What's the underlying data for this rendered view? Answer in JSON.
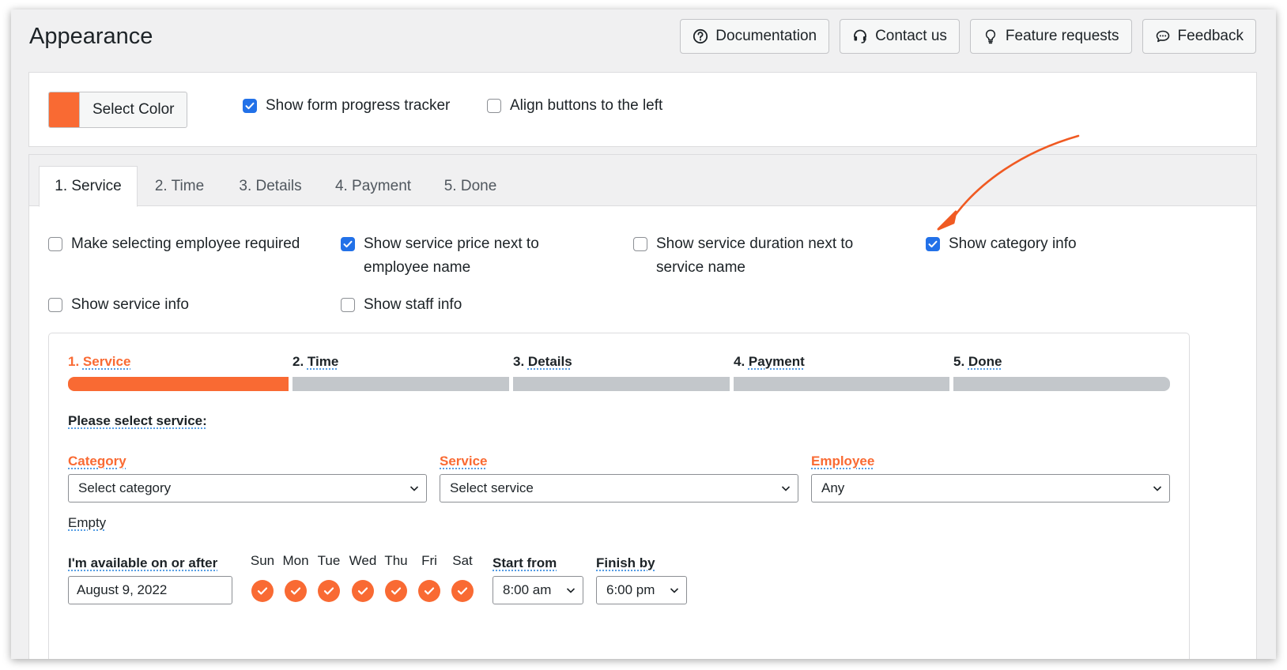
{
  "header": {
    "title": "Appearance",
    "buttons": [
      {
        "label": "Documentation",
        "icon": "question-circle-icon"
      },
      {
        "label": "Contact us",
        "icon": "headset-icon"
      },
      {
        "label": "Feature requests",
        "icon": "lightbulb-icon"
      },
      {
        "label": "Feedback",
        "icon": "chat-bubble-icon"
      }
    ]
  },
  "settings": {
    "select_color_label": "Select Color",
    "accent_color": "#f96a33",
    "show_progress_tracker": {
      "label": "Show form progress tracker",
      "checked": true
    },
    "align_left": {
      "label": "Align buttons to the left",
      "checked": false
    }
  },
  "tabs": [
    {
      "label": "1. Service",
      "active": true
    },
    {
      "label": "2. Time",
      "active": false
    },
    {
      "label": "3. Details",
      "active": false
    },
    {
      "label": "4. Payment",
      "active": false
    },
    {
      "label": "5. Done",
      "active": false
    }
  ],
  "options": {
    "employee_required": {
      "label": "Make selecting employee required",
      "checked": false
    },
    "service_price": {
      "label_line1": "Show service price next to",
      "label_line2": "employee name",
      "checked": true
    },
    "service_duration": {
      "label_line1": "Show service duration next to",
      "label_line2": "service name",
      "checked": false
    },
    "category_info": {
      "label": "Show category info",
      "checked": true
    },
    "service_info": {
      "label": "Show service info",
      "checked": false
    },
    "staff_info": {
      "label": "Show staff info",
      "checked": false
    }
  },
  "preview": {
    "steps": [
      {
        "num": "1.",
        "label": "Service",
        "active": true
      },
      {
        "num": "2.",
        "label": "Time",
        "active": false
      },
      {
        "num": "3.",
        "label": "Details",
        "active": false
      },
      {
        "num": "4.",
        "label": "Payment",
        "active": false
      },
      {
        "num": "5.",
        "label": "Done",
        "active": false
      }
    ],
    "heading": "Please select service:",
    "category": {
      "label": "Category",
      "value": "Select category"
    },
    "service": {
      "label": "Service",
      "value": "Select service"
    },
    "employee": {
      "label": "Employee",
      "value": "Any"
    },
    "empty_text": "Empty",
    "available_label": "I'm available on or after",
    "date_value": "August 9, 2022",
    "days": [
      "Sun",
      "Mon",
      "Tue",
      "Wed",
      "Thu",
      "Fri",
      "Sat"
    ],
    "start_from": {
      "label": "Start from",
      "value": "8:00 am"
    },
    "finish_by": {
      "label": "Finish by",
      "value": "6:00 pm"
    }
  }
}
